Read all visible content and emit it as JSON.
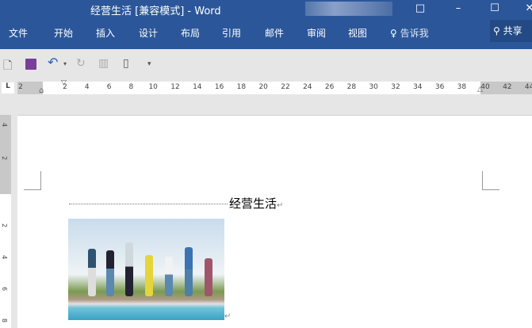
{
  "window": {
    "title": "经营生活 [兼容模式]  -  Word",
    "restore_icon": "□",
    "minimize": "–",
    "maximize": "☐",
    "close": "✕"
  },
  "tabs": [
    "文件",
    "开始",
    "插入",
    "设计",
    "布局",
    "引用",
    "邮件",
    "审阅",
    "视图"
  ],
  "tell_me": "告诉我",
  "share": "共享",
  "ruler": {
    "left_gray": [
      "2"
    ],
    "numbers": [
      "2",
      "4",
      "6",
      "8",
      "10",
      "12",
      "14",
      "16",
      "18",
      "20",
      "22",
      "24",
      "26",
      "28",
      "30",
      "32",
      "34",
      "36",
      "38"
    ],
    "right_gray": [
      "40",
      "42",
      "44"
    ],
    "tab_selector": "L"
  },
  "vruler": [
    "4",
    "2",
    "",
    "2",
    "4",
    "6",
    "8"
  ],
  "document": {
    "heading": "经营生活",
    "para_mark": "↵"
  },
  "colors": {
    "accent": "#2b579a"
  }
}
